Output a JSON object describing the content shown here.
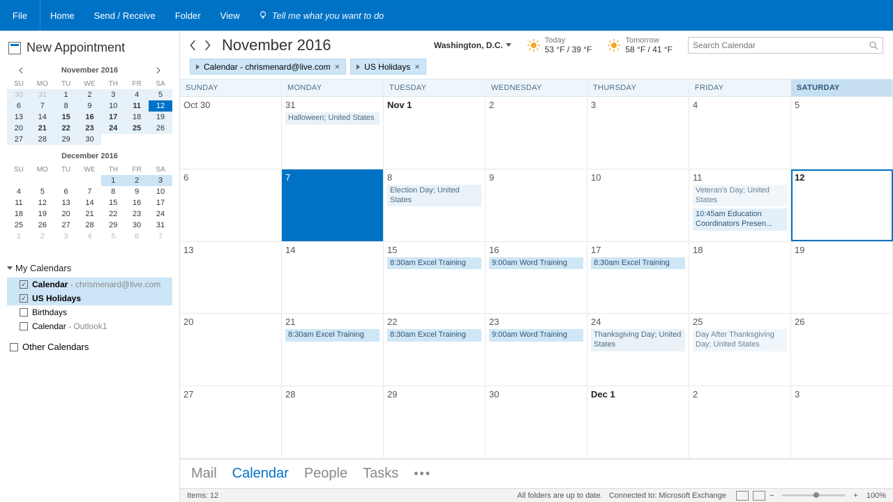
{
  "ribbon": {
    "file": "File",
    "home": "Home",
    "sendrec": "Send / Receive",
    "folder": "Folder",
    "view": "View",
    "tell": "Tell me what you want to do"
  },
  "side": {
    "newapt": "New Appointment",
    "nov": {
      "title": "November 2016",
      "dow": [
        "SU",
        "MO",
        "TU",
        "WE",
        "TH",
        "FR",
        "SA"
      ]
    },
    "dec": {
      "title": "December 2016"
    },
    "mycal": "My Calendars",
    "items": [
      {
        "chk": true,
        "label": "Calendar",
        "sub": " - chrismenard@live.com"
      },
      {
        "chk": true,
        "label": "US Holidays",
        "sub": ""
      },
      {
        "chk": false,
        "label": "Birthdays",
        "sub": ""
      },
      {
        "chk": false,
        "label": "Calendar",
        "sub": " - Outlook1"
      }
    ],
    "other": "Other Calendars"
  },
  "top": {
    "title": "November 2016",
    "loc": "Washington,  D.C.",
    "today": {
      "label": "Today",
      "temp": "53 °F / 39 °F"
    },
    "tomorrow": {
      "label": "Tomorrow",
      "temp": "58 °F / 41 °F"
    },
    "search_ph": "Search Calendar"
  },
  "tabs": {
    "t0": "Calendar - chrismenard@live.com",
    "t1": "US Holidays"
  },
  "dow": {
    "su": "SUNDAY",
    "mo": "MONDAY",
    "tu": "TUESDAY",
    "we": "WEDNESDAY",
    "th": "THURSDAY",
    "fr": "FRIDAY",
    "sa": "SATURDAY"
  },
  "cells": {
    "w0": {
      "d0": "Oct 30",
      "d1": "31",
      "d2": "Nov 1",
      "d3": "2",
      "d4": "3",
      "d5": "4",
      "d6": "5"
    },
    "w1": {
      "d0": "6",
      "d1": "7",
      "d2": "8",
      "d3": "9",
      "d4": "10",
      "d5": "11",
      "d6": "12"
    },
    "w2": {
      "d0": "13",
      "d1": "14",
      "d2": "15",
      "d3": "16",
      "d4": "17",
      "d5": "18",
      "d6": "19"
    },
    "w3": {
      "d0": "20",
      "d1": "21",
      "d2": "22",
      "d3": "23",
      "d4": "24",
      "d5": "25",
      "d6": "26"
    },
    "w4": {
      "d0": "27",
      "d1": "28",
      "d2": "29",
      "d3": "30",
      "d4": "Dec 1",
      "d5": "2",
      "d6": "3"
    }
  },
  "evt": {
    "halloween": "Halloween; United States",
    "election": "Election Day; United States",
    "vets": "Veteran's Day; United States",
    "edu": "10:45am Education Coordinators Presen...",
    "ex15": "8:30am Excel Training",
    "wd16": "9:00am Word Training",
    "ex17": "8:30am Excel Training",
    "ex21": "8:30am Excel Training",
    "ex22": "8:30am Excel Training",
    "wd23": "9:00am Word Training",
    "thx": "Thanksgiving Day; United States",
    "daft": "Day After Thanksgiving Day; United States"
  },
  "nav": {
    "mail": "Mail",
    "cal": "Calendar",
    "people": "People",
    "tasks": "Tasks"
  },
  "status": {
    "items": "Items: 12",
    "upd": "All folders are up to date.",
    "conn": "Connected to: Microsoft Exchange",
    "zoom": "100%"
  }
}
